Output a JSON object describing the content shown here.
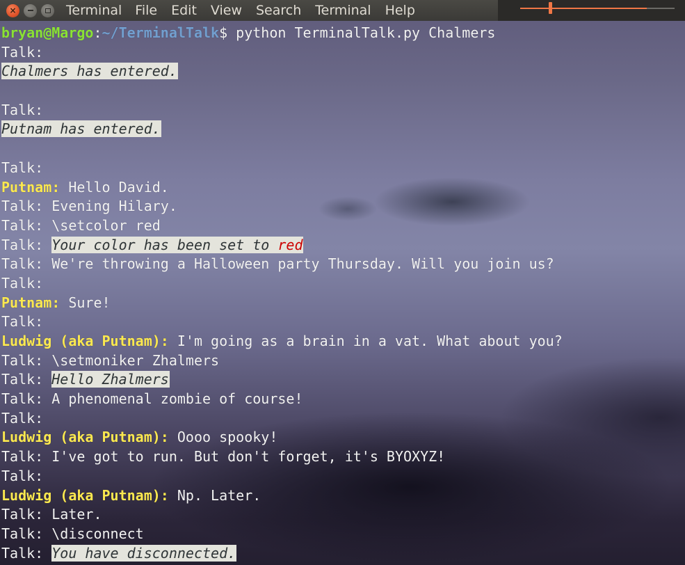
{
  "window": {
    "title": "Terminal",
    "menu": [
      "File",
      "Edit",
      "View",
      "Search",
      "Terminal",
      "Help"
    ],
    "buttons": {
      "close": "×"
    }
  },
  "prompt": {
    "user_host": "bryan@Margo",
    "separator": ":",
    "path": "~/TerminalTalk",
    "symbol": "$ ",
    "command": "python TerminalTalk.py Chalmers"
  },
  "lines": [
    {
      "kind": "talk",
      "prefix": "Talk:",
      "text": ""
    },
    {
      "kind": "notice",
      "text": "Chalmers has entered."
    },
    {
      "kind": "blank"
    },
    {
      "kind": "talk",
      "prefix": "Talk:",
      "text": ""
    },
    {
      "kind": "notice",
      "text": "Putnam has entered."
    },
    {
      "kind": "blank"
    },
    {
      "kind": "talk",
      "prefix": "Talk:",
      "text": ""
    },
    {
      "kind": "nick",
      "nick": "Putnam:",
      "text": " Hello David."
    },
    {
      "kind": "talk",
      "prefix": "Talk:",
      "text": " Evening Hilary."
    },
    {
      "kind": "talk",
      "prefix": "Talk:",
      "text": " \\setcolor red"
    },
    {
      "kind": "talk-notice",
      "prefix": "Talk: ",
      "text": "Your color has been set to ",
      "red": "red"
    },
    {
      "kind": "talk",
      "prefix": "Talk:",
      "text": " We're throwing a Halloween party Thursday. Will you join us?"
    },
    {
      "kind": "talk",
      "prefix": "Talk:",
      "text": ""
    },
    {
      "kind": "nick",
      "nick": "Putnam:",
      "text": " Sure!"
    },
    {
      "kind": "talk",
      "prefix": "Talk:",
      "text": ""
    },
    {
      "kind": "nick",
      "nick": "Ludwig (aka Putnam):",
      "text": " I'm going as a brain in a vat. What about you?"
    },
    {
      "kind": "talk",
      "prefix": "Talk:",
      "text": " \\setmoniker Zhalmers"
    },
    {
      "kind": "talk-notice",
      "prefix": "Talk: ",
      "text": "Hello Zhalmers"
    },
    {
      "kind": "talk",
      "prefix": "Talk:",
      "text": " A phenomenal zombie of course!"
    },
    {
      "kind": "talk",
      "prefix": "Talk:",
      "text": ""
    },
    {
      "kind": "nick",
      "nick": "Ludwig (aka Putnam):",
      "text": " Oooo spooky!"
    },
    {
      "kind": "talk",
      "prefix": "Talk:",
      "text": " I've got to run. But don't forget, it's BYOXYZ!"
    },
    {
      "kind": "talk",
      "prefix": "Talk:",
      "text": ""
    },
    {
      "kind": "nick",
      "nick": "Ludwig (aka Putnam):",
      "text": " Np. Later."
    },
    {
      "kind": "talk",
      "prefix": "Talk:",
      "text": " Later."
    },
    {
      "kind": "talk",
      "prefix": "Talk:",
      "text": " \\disconnect"
    },
    {
      "kind": "talk-notice",
      "prefix": "Talk: ",
      "text": "You have disconnected."
    }
  ],
  "colors": {
    "prompt_user": "#8ae234",
    "prompt_path": "#729fcf",
    "nick": "#fce94f",
    "notice_bg": "#e4e4dc",
    "accent": "#f07746",
    "red": "#cc0000"
  }
}
